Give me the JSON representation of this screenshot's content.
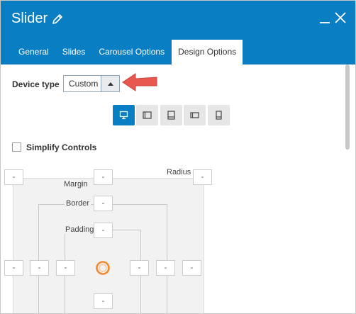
{
  "header": {
    "title": "Slider"
  },
  "tabs": [
    {
      "label": "General"
    },
    {
      "label": "Slides"
    },
    {
      "label": "Carousel Options"
    },
    {
      "label": "Design Options"
    }
  ],
  "design": {
    "device_type_label": "Device type",
    "device_type_value": "Custom",
    "devices": [
      "desktop-icon",
      "tablet-landscape-icon",
      "tablet-portrait-icon",
      "mobile-landscape-icon",
      "mobile-portrait-icon"
    ],
    "simplify_controls_label": "Simplify Controls",
    "box_model": {
      "margin_label": "Margin",
      "border_label": "Border",
      "padding_label": "Padding",
      "radius_label": "Radius",
      "placeholder": "-"
    }
  },
  "colors": {
    "accent": "#0a7ec2",
    "arrow": "#e8584e"
  }
}
